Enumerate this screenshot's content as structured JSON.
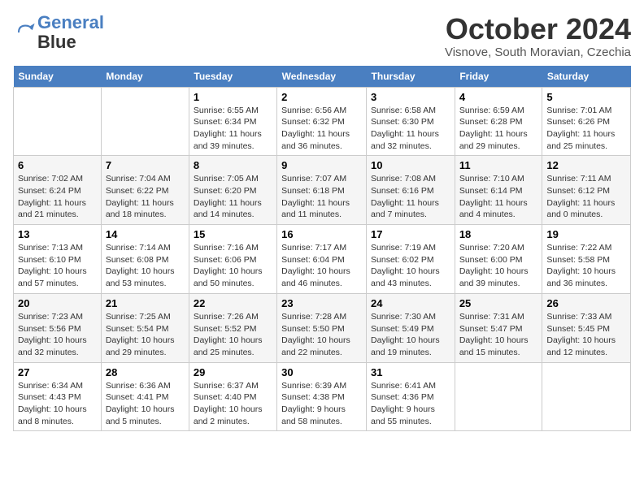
{
  "header": {
    "logo_line1": "General",
    "logo_line2": "Blue",
    "month_title": "October 2024",
    "location": "Visnove, South Moravian, Czechia"
  },
  "weekdays": [
    "Sunday",
    "Monday",
    "Tuesday",
    "Wednesday",
    "Thursday",
    "Friday",
    "Saturday"
  ],
  "weeks": [
    [
      {
        "day": "",
        "info": ""
      },
      {
        "day": "",
        "info": ""
      },
      {
        "day": "1",
        "info": "Sunrise: 6:55 AM\nSunset: 6:34 PM\nDaylight: 11 hours and 39 minutes."
      },
      {
        "day": "2",
        "info": "Sunrise: 6:56 AM\nSunset: 6:32 PM\nDaylight: 11 hours and 36 minutes."
      },
      {
        "day": "3",
        "info": "Sunrise: 6:58 AM\nSunset: 6:30 PM\nDaylight: 11 hours and 32 minutes."
      },
      {
        "day": "4",
        "info": "Sunrise: 6:59 AM\nSunset: 6:28 PM\nDaylight: 11 hours and 29 minutes."
      },
      {
        "day": "5",
        "info": "Sunrise: 7:01 AM\nSunset: 6:26 PM\nDaylight: 11 hours and 25 minutes."
      }
    ],
    [
      {
        "day": "6",
        "info": "Sunrise: 7:02 AM\nSunset: 6:24 PM\nDaylight: 11 hours and 21 minutes."
      },
      {
        "day": "7",
        "info": "Sunrise: 7:04 AM\nSunset: 6:22 PM\nDaylight: 11 hours and 18 minutes."
      },
      {
        "day": "8",
        "info": "Sunrise: 7:05 AM\nSunset: 6:20 PM\nDaylight: 11 hours and 14 minutes."
      },
      {
        "day": "9",
        "info": "Sunrise: 7:07 AM\nSunset: 6:18 PM\nDaylight: 11 hours and 11 minutes."
      },
      {
        "day": "10",
        "info": "Sunrise: 7:08 AM\nSunset: 6:16 PM\nDaylight: 11 hours and 7 minutes."
      },
      {
        "day": "11",
        "info": "Sunrise: 7:10 AM\nSunset: 6:14 PM\nDaylight: 11 hours and 4 minutes."
      },
      {
        "day": "12",
        "info": "Sunrise: 7:11 AM\nSunset: 6:12 PM\nDaylight: 11 hours and 0 minutes."
      }
    ],
    [
      {
        "day": "13",
        "info": "Sunrise: 7:13 AM\nSunset: 6:10 PM\nDaylight: 10 hours and 57 minutes."
      },
      {
        "day": "14",
        "info": "Sunrise: 7:14 AM\nSunset: 6:08 PM\nDaylight: 10 hours and 53 minutes."
      },
      {
        "day": "15",
        "info": "Sunrise: 7:16 AM\nSunset: 6:06 PM\nDaylight: 10 hours and 50 minutes."
      },
      {
        "day": "16",
        "info": "Sunrise: 7:17 AM\nSunset: 6:04 PM\nDaylight: 10 hours and 46 minutes."
      },
      {
        "day": "17",
        "info": "Sunrise: 7:19 AM\nSunset: 6:02 PM\nDaylight: 10 hours and 43 minutes."
      },
      {
        "day": "18",
        "info": "Sunrise: 7:20 AM\nSunset: 6:00 PM\nDaylight: 10 hours and 39 minutes."
      },
      {
        "day": "19",
        "info": "Sunrise: 7:22 AM\nSunset: 5:58 PM\nDaylight: 10 hours and 36 minutes."
      }
    ],
    [
      {
        "day": "20",
        "info": "Sunrise: 7:23 AM\nSunset: 5:56 PM\nDaylight: 10 hours and 32 minutes."
      },
      {
        "day": "21",
        "info": "Sunrise: 7:25 AM\nSunset: 5:54 PM\nDaylight: 10 hours and 29 minutes."
      },
      {
        "day": "22",
        "info": "Sunrise: 7:26 AM\nSunset: 5:52 PM\nDaylight: 10 hours and 25 minutes."
      },
      {
        "day": "23",
        "info": "Sunrise: 7:28 AM\nSunset: 5:50 PM\nDaylight: 10 hours and 22 minutes."
      },
      {
        "day": "24",
        "info": "Sunrise: 7:30 AM\nSunset: 5:49 PM\nDaylight: 10 hours and 19 minutes."
      },
      {
        "day": "25",
        "info": "Sunrise: 7:31 AM\nSunset: 5:47 PM\nDaylight: 10 hours and 15 minutes."
      },
      {
        "day": "26",
        "info": "Sunrise: 7:33 AM\nSunset: 5:45 PM\nDaylight: 10 hours and 12 minutes."
      }
    ],
    [
      {
        "day": "27",
        "info": "Sunrise: 6:34 AM\nSunset: 4:43 PM\nDaylight: 10 hours and 8 minutes."
      },
      {
        "day": "28",
        "info": "Sunrise: 6:36 AM\nSunset: 4:41 PM\nDaylight: 10 hours and 5 minutes."
      },
      {
        "day": "29",
        "info": "Sunrise: 6:37 AM\nSunset: 4:40 PM\nDaylight: 10 hours and 2 minutes."
      },
      {
        "day": "30",
        "info": "Sunrise: 6:39 AM\nSunset: 4:38 PM\nDaylight: 9 hours and 58 minutes."
      },
      {
        "day": "31",
        "info": "Sunrise: 6:41 AM\nSunset: 4:36 PM\nDaylight: 9 hours and 55 minutes."
      },
      {
        "day": "",
        "info": ""
      },
      {
        "day": "",
        "info": ""
      }
    ]
  ]
}
